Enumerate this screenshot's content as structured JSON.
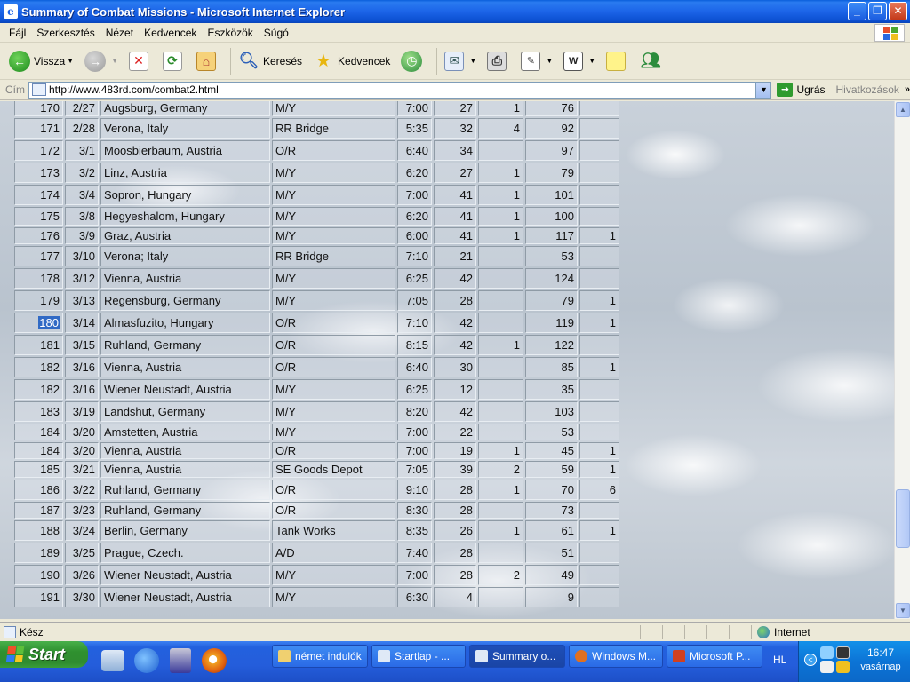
{
  "window": {
    "title": "Summary of Combat Missions - Microsoft Internet Explorer"
  },
  "menu": [
    "Fájl",
    "Szerkesztés",
    "Nézet",
    "Kedvencek",
    "Eszközök",
    "Súgó"
  ],
  "toolbar": {
    "back_label": "Vissza",
    "search_label": "Keresés",
    "favorites_label": "Kedvencek"
  },
  "address": {
    "label": "Cím",
    "url": "http://www.483rd.com/combat2.html",
    "go_label": "Ugrás",
    "links_label": "Hivatkozások"
  },
  "missions": [
    [
      "170",
      "2/27",
      "Augsburg, Germany",
      "M/Y",
      "7:00",
      "27",
      "1",
      "76",
      ""
    ],
    [
      "171",
      "2/28",
      "Verona, Italy",
      "RR Bridge",
      "5:35",
      "32",
      "4",
      "92",
      ""
    ],
    [
      "172",
      "3/1",
      "Moosbierbaum, Austria",
      "O/R",
      "6:40",
      "34",
      "",
      "97",
      ""
    ],
    [
      "173",
      "3/2",
      "Linz, Austria",
      "M/Y",
      "6:20",
      "27",
      "1",
      "79",
      ""
    ],
    [
      "174",
      "3/4",
      "Sopron, Hungary",
      "M/Y",
      "7:00",
      "41",
      "1",
      "101",
      ""
    ],
    [
      "175",
      "3/8",
      "Hegyeshalom, Hungary",
      "M/Y",
      "6:20",
      "41",
      "1",
      "100",
      ""
    ],
    [
      "176",
      "3/9",
      "Graz, Austria",
      "M/Y",
      "6:00",
      "41",
      "1",
      "117",
      "1"
    ],
    [
      "177",
      "3/10",
      "Verona; Italy",
      "RR Bridge",
      "7:10",
      "21",
      "",
      "53",
      ""
    ],
    [
      "178",
      "3/12",
      "Vienna, Austria",
      "M/Y",
      "6:25",
      "42",
      "",
      "124",
      ""
    ],
    [
      "179",
      "3/13",
      "Regensburg, Germany",
      "M/Y",
      "7:05",
      "28",
      "",
      "79",
      "1"
    ],
    [
      "180",
      "3/14",
      "Almasfuzito, Hungary",
      "O/R",
      "7:10",
      "42",
      "",
      "119",
      "1"
    ],
    [
      "181",
      "3/15",
      "Ruhland, Germany",
      "O/R",
      "8:15",
      "42",
      "1",
      "122",
      ""
    ],
    [
      "182",
      "3/16",
      "Vienna, Austria",
      "O/R",
      "6:40",
      "30",
      "",
      "85",
      "1"
    ],
    [
      "182",
      "3/16",
      "Wiener Neustadt, Austria",
      "M/Y",
      "6:25",
      "12",
      "",
      "35",
      ""
    ],
    [
      "183",
      "3/19",
      "Landshut, Germany",
      "M/Y",
      "8:20",
      "42",
      "",
      "103",
      ""
    ],
    [
      "184",
      "3/20",
      "Amstetten, Austria",
      "M/Y",
      "7:00",
      "22",
      "",
      "53",
      ""
    ],
    [
      "184",
      "3/20",
      "Vienna, Austria",
      "O/R",
      "7:00",
      "19",
      "1",
      "45",
      "1"
    ],
    [
      "185",
      "3/21",
      "Vienna, Austria",
      "SE Goods Depot",
      "7:05",
      "39",
      "2",
      "59",
      "1"
    ],
    [
      "186",
      "3/22",
      "Ruhland, Germany",
      "O/R",
      "9:10",
      "28",
      "1",
      "70",
      "6"
    ],
    [
      "187",
      "3/23",
      "Ruhland, Germany",
      "O/R",
      "8:30",
      "28",
      "",
      "73",
      ""
    ],
    [
      "188",
      "3/24",
      "Berlin, Germany",
      "Tank Works",
      "8:35",
      "26",
      "1",
      "61",
      "1"
    ],
    [
      "189",
      "3/25",
      "Prague, Czech.",
      "A/D",
      "7:40",
      "28",
      "",
      "51",
      ""
    ],
    [
      "190",
      "3/26",
      "Wiener Neustadt, Austria",
      "M/Y",
      "7:00",
      "28",
      "2",
      "49",
      ""
    ],
    [
      "191",
      "3/30",
      "Wiener Neustadt, Austria",
      "M/Y",
      "6:30",
      "4",
      "",
      "9",
      ""
    ]
  ],
  "row_heights": [],
  "selection": {
    "row_index": 10,
    "text": "180"
  },
  "status": {
    "text": "Kész",
    "zone": "Internet"
  },
  "taskbar": {
    "start_label": "Start",
    "tasks": [
      "német indulók",
      "Startlap - ...",
      "Summary o...",
      "Windows M...",
      "Microsoft P..."
    ],
    "active_task": 2,
    "language": "HL",
    "time": "16:47",
    "day": "vasárnap"
  },
  "colors": {
    "title_bar": "#1c64e8",
    "selection": "#316ac5",
    "start_button": "#2f902f",
    "taskbar": "#245ddb"
  },
  "icons": [
    "back-icon",
    "forward-icon",
    "stop-icon",
    "refresh-icon",
    "home-icon",
    "search-icon",
    "favorites-icon",
    "history-icon",
    "mail-icon",
    "print-icon",
    "edit-icon",
    "word-icon",
    "note-icon",
    "messenger-icon"
  ]
}
